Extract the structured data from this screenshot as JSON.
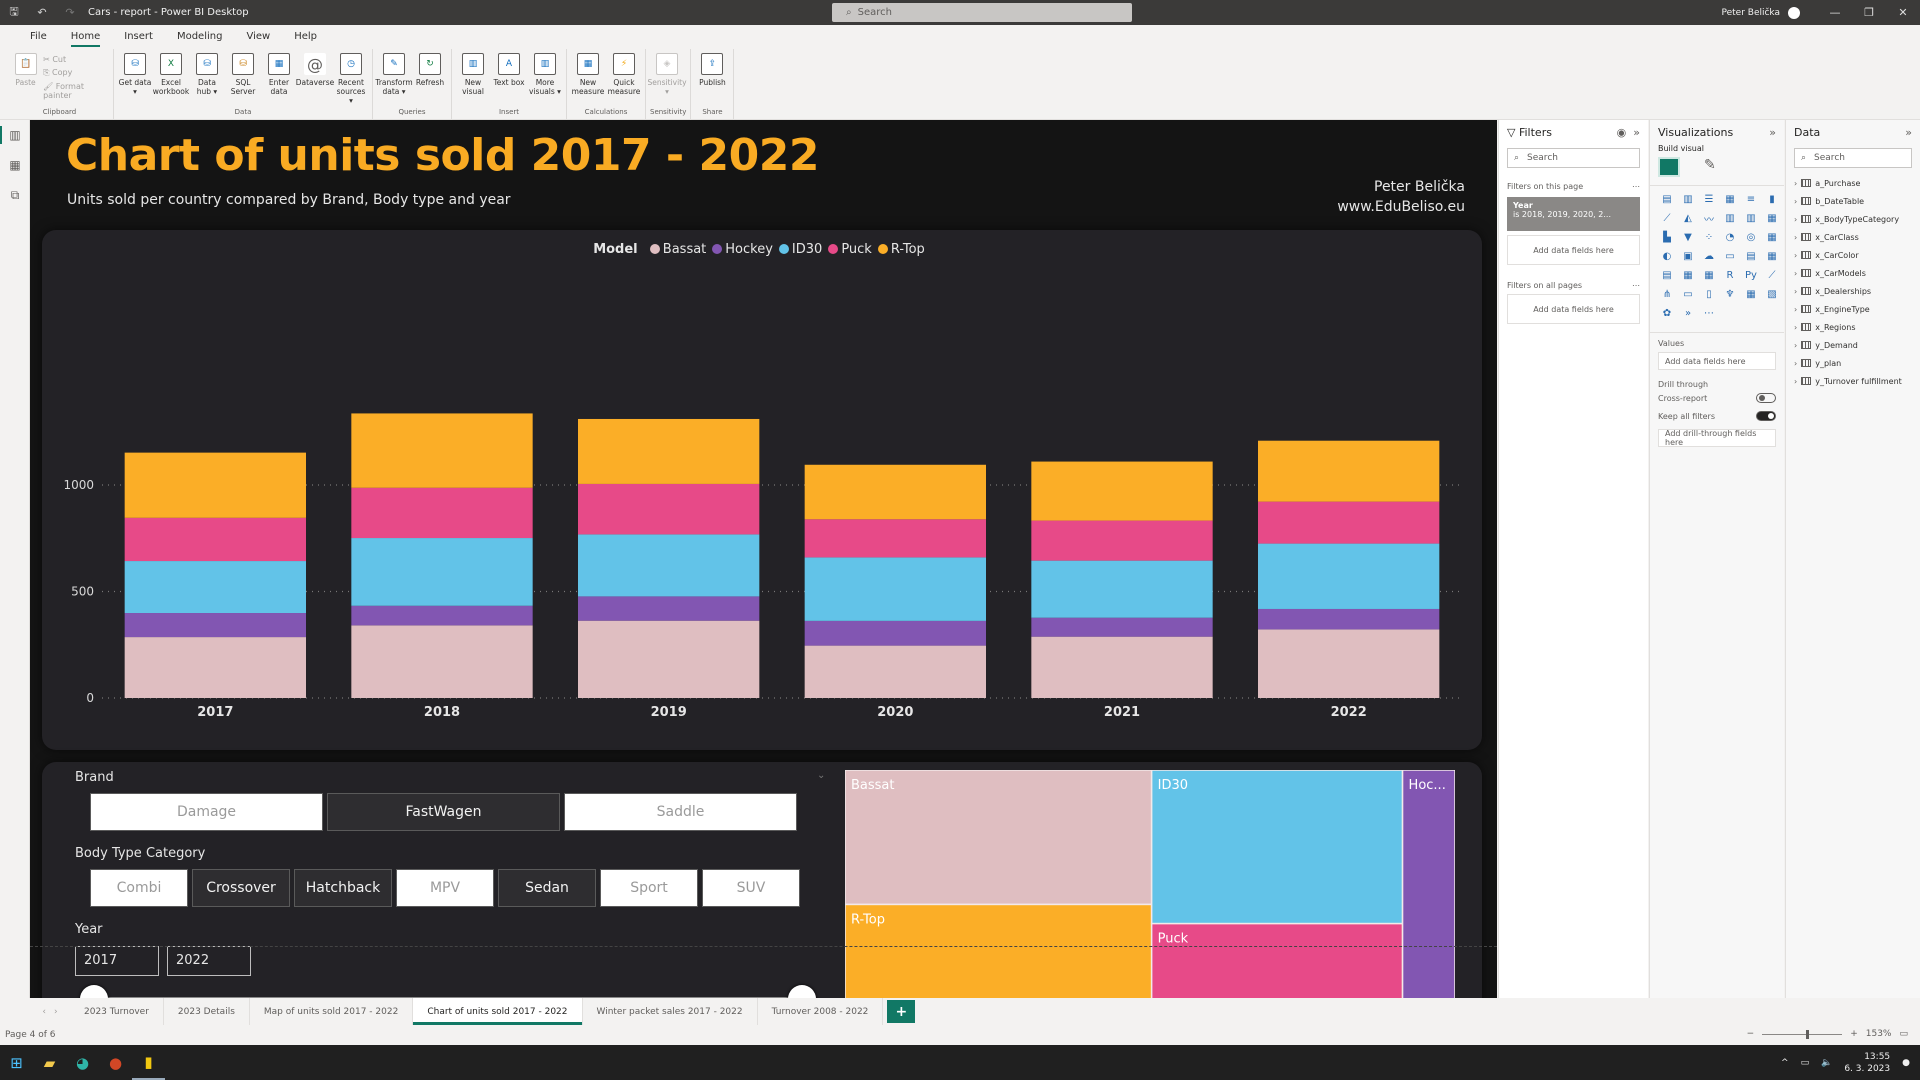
{
  "window": {
    "title": "Cars - report - Power BI Desktop",
    "search_placeholder": "Search",
    "user": "Peter Belička",
    "controls": {
      "minimize": "—",
      "restore": "❐",
      "close": "✕"
    }
  },
  "menu": {
    "items": [
      "File",
      "Home",
      "Insert",
      "Modeling",
      "View",
      "Help"
    ],
    "active": "Home"
  },
  "ribbon": {
    "clipboard": {
      "paste": "Paste",
      "cut": "Cut",
      "copy": "Copy",
      "format_painter": "Format painter",
      "label": "Clipboard"
    },
    "data": {
      "label": "Data",
      "buttons": [
        "Get data ▾",
        "Excel workbook",
        "Data hub ▾",
        "SQL Server",
        "Enter data",
        "Dataverse",
        "Recent sources ▾"
      ]
    },
    "queries": {
      "label": "Queries",
      "buttons": [
        "Transform data ▾",
        "Refresh"
      ]
    },
    "insert": {
      "label": "Insert",
      "buttons": [
        "New visual",
        "Text box",
        "More visuals ▾"
      ]
    },
    "calculations": {
      "label": "Calculations",
      "buttons": [
        "New measure",
        "Quick measure"
      ]
    },
    "sensitivity": {
      "label": "Sensitivity",
      "buttons": [
        "Sensitivity ▾"
      ]
    },
    "share": {
      "label": "Share",
      "buttons": [
        "Publish"
      ]
    }
  },
  "report": {
    "title": "Chart of units sold 2017 - 2022",
    "subtitle": "Units sold per country compared by Brand, Body type and year",
    "author_name": "Peter Belička",
    "author_site": "www.EduBeliso.eu",
    "colors": {
      "title": "#f9ab23",
      "Bassat": "#dfbec1",
      "Hockey": "#8256b2",
      "ID30": "#62c3e8",
      "Puck": "#e74a88",
      "R-Top": "#fbae27"
    }
  },
  "chart_data": [
    {
      "type": "bar",
      "stacked": true,
      "title": "",
      "legend_title": "Model",
      "legend_position": "top-center",
      "categories": [
        "2017",
        "2018",
        "2019",
        "2020",
        "2021",
        "2022"
      ],
      "series": [
        {
          "name": "Bassat",
          "values": [
            286,
            341,
            363,
            246,
            288,
            322
          ]
        },
        {
          "name": "Hockey",
          "values": [
            113,
            92,
            114,
            116,
            89,
            96
          ]
        },
        {
          "name": "ID30",
          "values": [
            244,
            318,
            291,
            298,
            268,
            307
          ]
        },
        {
          "name": "Puck",
          "values": [
            203,
            236,
            237,
            179,
            188,
            197
          ]
        },
        {
          "name": "R-Top",
          "values": [
            306,
            349,
            305,
            256,
            277,
            286
          ]
        }
      ],
      "xlabel": "",
      "ylabel": "",
      "yticks": [
        0,
        500,
        1000
      ],
      "ylim": [
        0,
        1400
      ],
      "grid": true
    },
    {
      "type": "treemap",
      "title": "",
      "categories": [
        "Bassat",
        "R-Top",
        "ID30",
        "Puck",
        "Hockey"
      ],
      "labels": [
        "Bassat",
        "R-Top",
        "ID30",
        "Puck",
        "Hoc..."
      ],
      "values": [
        1846,
        1779,
        1726,
        1240,
        620
      ]
    }
  ],
  "slicers": {
    "brand": {
      "label": "Brand",
      "options": [
        {
          "label": "Damage",
          "selected": false
        },
        {
          "label": "FastWagen",
          "selected": true
        },
        {
          "label": "Saddle",
          "selected": false
        }
      ]
    },
    "body_type": {
      "label": "Body Type Category",
      "options": [
        {
          "label": "Combi",
          "selected": false
        },
        {
          "label": "Crossover",
          "selected": true
        },
        {
          "label": "Hatchback",
          "selected": true
        },
        {
          "label": "MPV",
          "selected": false
        },
        {
          "label": "Sedan",
          "selected": true
        },
        {
          "label": "Sport",
          "selected": false
        },
        {
          "label": "SUV",
          "selected": false
        }
      ]
    },
    "year": {
      "label": "Year",
      "from": "2017",
      "to": "2022",
      "min": 2017,
      "max": 2022
    }
  },
  "filters_pane": {
    "title": "Filters",
    "search_placeholder": "Search",
    "on_this_page": "Filters on this page",
    "filter_card": {
      "field": "Year",
      "value": "is 2018, 2019, 2020, 2..."
    },
    "add_fields": "Add data fields here",
    "on_all_pages": "Filters on all pages"
  },
  "viz_pane": {
    "title": "Visualizations",
    "build_visual": "Build visual",
    "values_label": "Values",
    "add_fields": "Add data fields here",
    "drill_through": "Drill through",
    "cross_report": "Cross-report",
    "cross_report_state": "Off",
    "keep_all_filters": "Keep all filters",
    "keep_all_filters_state": "On",
    "add_drill": "Add drill-through fields here",
    "icons": [
      "▤",
      "▥",
      "☰",
      "▦",
      "≡",
      "▮",
      "⟋",
      "◭",
      "〰",
      "▥",
      "▥",
      "▦",
      "▙",
      "▼",
      "⁘",
      "◔",
      "◎",
      "▦",
      "◐",
      "▣",
      "☁",
      "▭",
      "▤",
      "▦",
      "▤",
      "▦",
      "▦",
      "R",
      "Py",
      "⟋",
      "⋔",
      "▭",
      "▯",
      "♆",
      "▦",
      "▧",
      "✿",
      "»",
      "⋯"
    ]
  },
  "data_pane": {
    "title": "Data",
    "search_placeholder": "Search",
    "tables": [
      "a_Purchase",
      "b_DateTable",
      "x_BodyTypeCategory",
      "x_CarClass",
      "x_CarColor",
      "x_CarModels",
      "x_Dealerships",
      "x_EngineType",
      "x_Regions",
      "y_Demand",
      "y_plan",
      "y_Turnover fulfillment"
    ]
  },
  "page_tabs": {
    "tabs": [
      "2023 Turnover",
      "2023 Details",
      "Map of units sold 2017 - 2022",
      "Chart of units sold 2017 - 2022",
      "Winter packet sales 2017 - 2022",
      "Turnover 2008 - 2022"
    ],
    "active_index": 3,
    "add": "+"
  },
  "status": {
    "page": "Page 4 of 6",
    "zoom": "153%"
  },
  "taskbar": {
    "time": "13:55",
    "date": "6. 3. 2023"
  }
}
